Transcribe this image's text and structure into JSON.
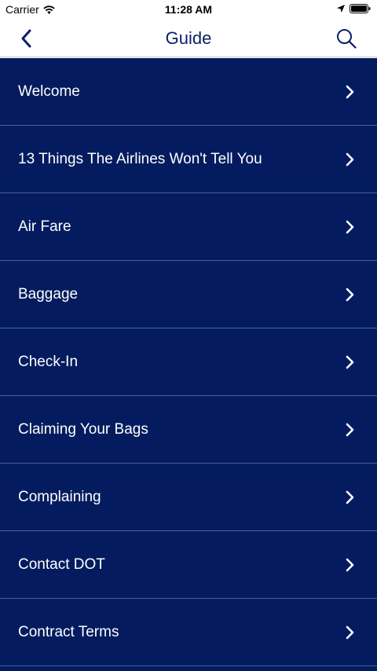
{
  "status_bar": {
    "carrier": "Carrier",
    "time": "11:28 AM"
  },
  "nav": {
    "title": "Guide",
    "back_icon": "chevron-left-icon",
    "search_icon": "search-icon"
  },
  "colors": {
    "list_background": "#041c5f",
    "divider": "#4a5f97",
    "nav_accent": "#0a1f66"
  },
  "guide_items": [
    {
      "label": "Welcome"
    },
    {
      "label": "13 Things The Airlines Won't Tell You"
    },
    {
      "label": "Air Fare"
    },
    {
      "label": "Baggage"
    },
    {
      "label": "Check-In"
    },
    {
      "label": "Claiming Your Bags"
    },
    {
      "label": "Complaining"
    },
    {
      "label": "Contact DOT"
    },
    {
      "label": "Contract Terms"
    }
  ]
}
